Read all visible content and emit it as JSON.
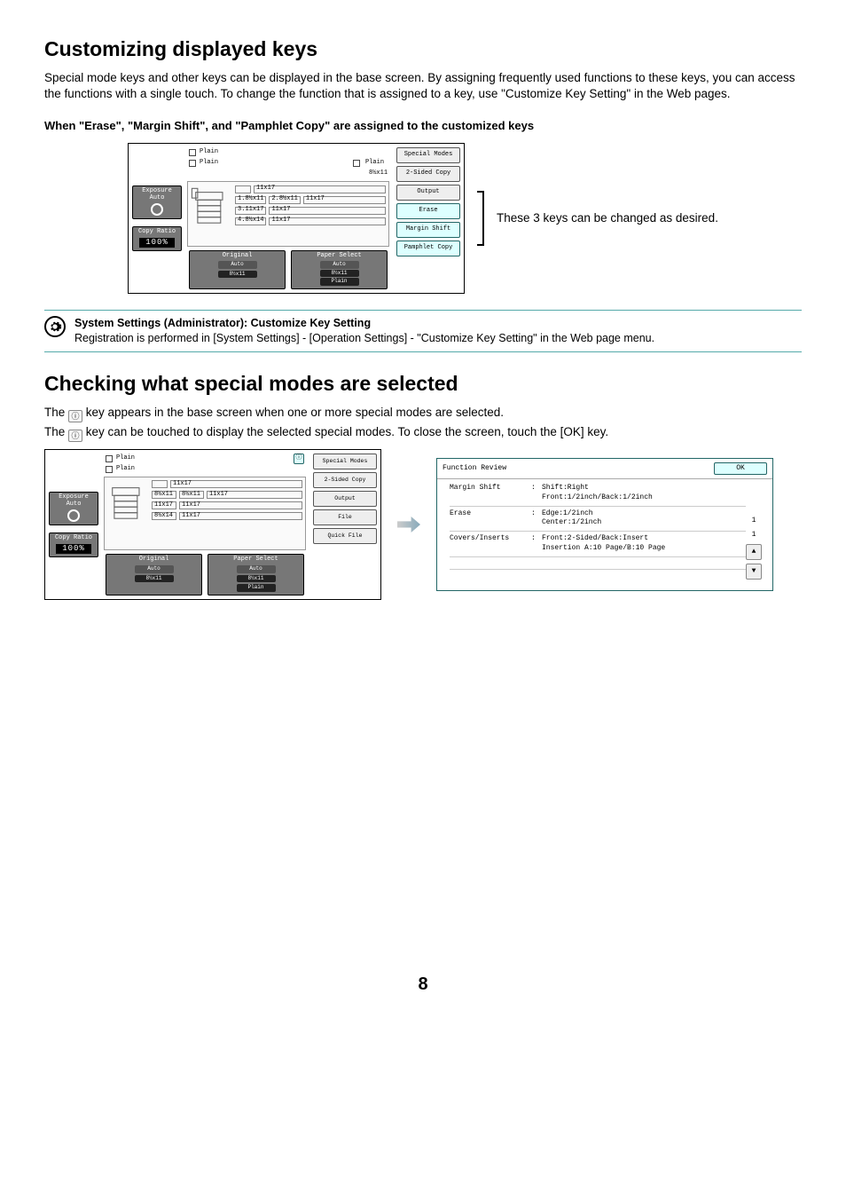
{
  "headings": {
    "main1": "Customizing displayed keys",
    "main2": "Checking what special modes are selected"
  },
  "intro1": "Special mode keys and other keys can be displayed in the base screen. By assigning frequently used functions to these keys, you can access the functions with a single touch. To change the function that is assigned to a key, use \"Customize Key Setting\" in the Web pages.",
  "example_heading": "When \"Erase\", \"Margin Shift\", and \"Pamphlet Copy\" are assigned to the customized keys",
  "figure_note": "These 3 keys can be changed as desired.",
  "note": {
    "title": "System Settings (Administrator): Customize Key Setting",
    "body": "Registration is performed in [System Settings] - [Operation Settings] - \"Customize Key Setting\" in the Web page menu."
  },
  "intro2a_pre": "The ",
  "intro2a_post": " key appears in the base screen when one or more special modes are selected.",
  "intro2b_pre": "The ",
  "intro2b_post": " key can be touched to display the selected special modes. To close the screen, touch the [OK] key.",
  "panel1": {
    "status1_type": "Plain",
    "status2_type": "Plain",
    "status_size": "8½x11",
    "status_type_r": "Plain",
    "exposure": {
      "label": "Exposure",
      "value": "Auto"
    },
    "copyratio": {
      "label": "Copy Ratio",
      "value": "100%"
    },
    "trays": {
      "t1a": "8½x11",
      "t1b": "8½x11",
      "t2a": "11x17",
      "t2b": "8½x14",
      "r1": "11x17",
      "r2": "11x17",
      "r3": "11x17",
      "r4": "11x17"
    },
    "bkeys": {
      "original": {
        "label": "Original",
        "v1": "Auto",
        "v2": "8½x11"
      },
      "paper": {
        "label": "Paper Select",
        "v1": "Auto",
        "v2": "8½x11",
        "v3": "Plain"
      }
    },
    "rkeys": [
      "Special Modes",
      "2-Sided Copy",
      "Output",
      "Erase",
      "Margin Shift",
      "Pamphlet Copy"
    ]
  },
  "panel2": {
    "rkeys": [
      "Special Modes",
      "2-Sided Copy",
      "Output",
      "File",
      "Quick File"
    ]
  },
  "review": {
    "title": "Function Review",
    "ok": "OK",
    "rows": [
      {
        "label": "Margin Shift",
        "text": "Shift:Right\nFront:1/2inch/Back:1/2inch"
      },
      {
        "label": "Erase",
        "text": "Edge:1/2inch\nCenter:1/2inch"
      },
      {
        "label": "Covers/Inserts",
        "text": "Front:2-Sided/Back:Insert\nInsertion A:10 Page/B:10 Page"
      }
    ],
    "page_top": "1",
    "page_bot": "1"
  },
  "page_number": "8"
}
